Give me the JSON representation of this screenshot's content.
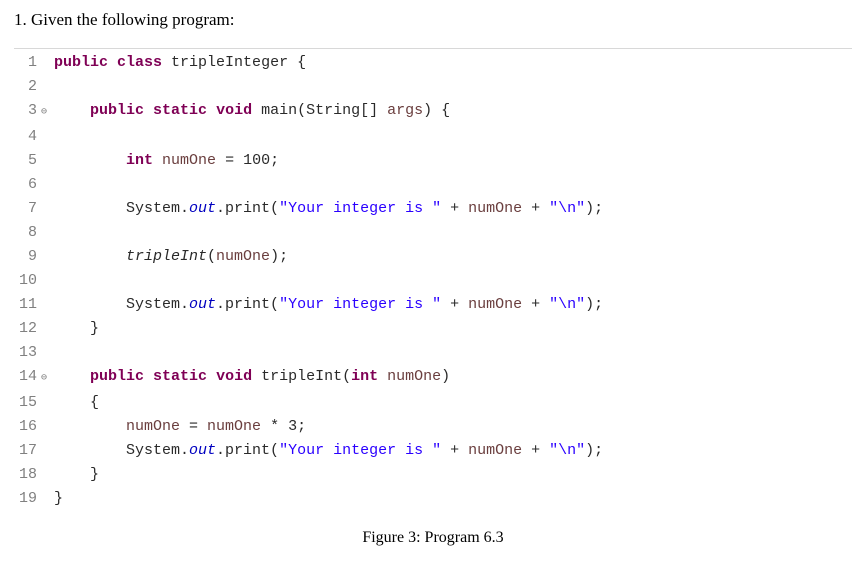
{
  "question": "1. Given the following program:",
  "figure_caption": "Figure 3: Program 6.3",
  "code": {
    "lines": [
      {
        "n": "1",
        "fold": "",
        "tokens": [
          {
            "t": "public",
            "c": "kw"
          },
          {
            "t": " ",
            "c": "plain"
          },
          {
            "t": "class",
            "c": "kw"
          },
          {
            "t": " tripleInteger {",
            "c": "plain"
          }
        ]
      },
      {
        "n": "2",
        "fold": "",
        "tokens": []
      },
      {
        "n": "3",
        "fold": "⊖",
        "tokens": [
          {
            "t": "    ",
            "c": "plain"
          },
          {
            "t": "public",
            "c": "kw"
          },
          {
            "t": " ",
            "c": "plain"
          },
          {
            "t": "static",
            "c": "kw"
          },
          {
            "t": " ",
            "c": "plain"
          },
          {
            "t": "void",
            "c": "type"
          },
          {
            "t": " main(String[] ",
            "c": "plain"
          },
          {
            "t": "args",
            "c": "local"
          },
          {
            "t": ") {",
            "c": "plain"
          }
        ]
      },
      {
        "n": "4",
        "fold": "",
        "tokens": []
      },
      {
        "n": "5",
        "fold": "",
        "tokens": [
          {
            "t": "        ",
            "c": "plain"
          },
          {
            "t": "int",
            "c": "type"
          },
          {
            "t": " ",
            "c": "plain"
          },
          {
            "t": "numOne",
            "c": "local"
          },
          {
            "t": " = 100;",
            "c": "plain"
          }
        ]
      },
      {
        "n": "6",
        "fold": "",
        "tokens": []
      },
      {
        "n": "7",
        "fold": "",
        "tokens": [
          {
            "t": "        System.",
            "c": "plain"
          },
          {
            "t": "out",
            "c": "static-field"
          },
          {
            "t": ".print(",
            "c": "plain"
          },
          {
            "t": "\"Your integer is \"",
            "c": "string"
          },
          {
            "t": " + ",
            "c": "plain"
          },
          {
            "t": "numOne",
            "c": "local"
          },
          {
            "t": " + ",
            "c": "plain"
          },
          {
            "t": "\"\\n\"",
            "c": "string"
          },
          {
            "t": ");",
            "c": "plain"
          }
        ]
      },
      {
        "n": "8",
        "fold": "",
        "tokens": []
      },
      {
        "n": "9",
        "fold": "",
        "tokens": [
          {
            "t": "        ",
            "c": "plain"
          },
          {
            "t": "tripleInt",
            "c": "method-static-ital"
          },
          {
            "t": "(",
            "c": "plain"
          },
          {
            "t": "numOne",
            "c": "local"
          },
          {
            "t": ");",
            "c": "plain"
          }
        ]
      },
      {
        "n": "10",
        "fold": "",
        "tokens": []
      },
      {
        "n": "11",
        "fold": "",
        "tokens": [
          {
            "t": "        System.",
            "c": "plain"
          },
          {
            "t": "out",
            "c": "static-field"
          },
          {
            "t": ".print(",
            "c": "plain"
          },
          {
            "t": "\"Your integer is \"",
            "c": "string"
          },
          {
            "t": " + ",
            "c": "plain"
          },
          {
            "t": "numOne",
            "c": "local"
          },
          {
            "t": " + ",
            "c": "plain"
          },
          {
            "t": "\"\\n\"",
            "c": "string"
          },
          {
            "t": ");",
            "c": "plain"
          }
        ]
      },
      {
        "n": "12",
        "fold": "",
        "tokens": [
          {
            "t": "    }",
            "c": "plain"
          }
        ]
      },
      {
        "n": "13",
        "fold": "",
        "tokens": []
      },
      {
        "n": "14",
        "fold": "⊖",
        "tokens": [
          {
            "t": "    ",
            "c": "plain"
          },
          {
            "t": "public",
            "c": "kw"
          },
          {
            "t": " ",
            "c": "plain"
          },
          {
            "t": "static",
            "c": "kw"
          },
          {
            "t": " ",
            "c": "plain"
          },
          {
            "t": "void",
            "c": "type"
          },
          {
            "t": " tripleInt(",
            "c": "plain"
          },
          {
            "t": "int",
            "c": "type"
          },
          {
            "t": " ",
            "c": "plain"
          },
          {
            "t": "numOne",
            "c": "local"
          },
          {
            "t": ")",
            "c": "plain"
          }
        ]
      },
      {
        "n": "15",
        "fold": "",
        "tokens": [
          {
            "t": "    {",
            "c": "plain"
          }
        ]
      },
      {
        "n": "16",
        "fold": "",
        "tokens": [
          {
            "t": "        ",
            "c": "plain"
          },
          {
            "t": "numOne",
            "c": "local"
          },
          {
            "t": " = ",
            "c": "plain"
          },
          {
            "t": "numOne",
            "c": "local"
          },
          {
            "t": " * 3;",
            "c": "plain"
          }
        ]
      },
      {
        "n": "17",
        "fold": "",
        "tokens": [
          {
            "t": "        System.",
            "c": "plain"
          },
          {
            "t": "out",
            "c": "static-field"
          },
          {
            "t": ".print(",
            "c": "plain"
          },
          {
            "t": "\"Your integer is \"",
            "c": "string"
          },
          {
            "t": " + ",
            "c": "plain"
          },
          {
            "t": "numOne",
            "c": "local"
          },
          {
            "t": " + ",
            "c": "plain"
          },
          {
            "t": "\"\\n\"",
            "c": "string"
          },
          {
            "t": ");",
            "c": "plain"
          }
        ]
      },
      {
        "n": "18",
        "fold": "",
        "tokens": [
          {
            "t": "    }",
            "c": "plain"
          }
        ]
      },
      {
        "n": "19",
        "fold": "",
        "tokens": [
          {
            "t": "}",
            "c": "plain"
          }
        ]
      }
    ]
  }
}
